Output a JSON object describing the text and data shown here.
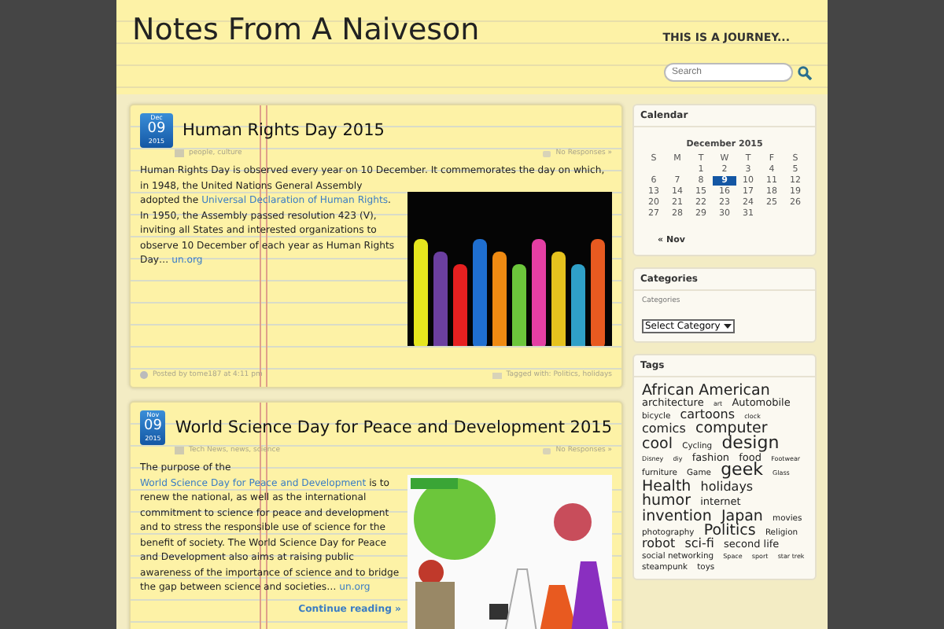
{
  "header": {
    "title": "Notes From A Naiveson",
    "tagline": "THIS IS A JOURNEY...",
    "search": {
      "placeholder": "Search"
    }
  },
  "posts": [
    {
      "date": {
        "month": "Dec",
        "day": "09",
        "year": "2015"
      },
      "title": "Human Rights Day 2015",
      "categories": "people, culture",
      "responses": "No Responses »",
      "body": [
        {
          "text": "Human Rights Day is observed every year on 10 December. It commemorates the day on which, in 1948, the United Nations General Assembly adopted the "
        },
        {
          "text": "Universal Declaration of Human",
          "link": true
        },
        {
          "text": "Rights",
          "link": true
        },
        {
          "text": ". In 1950, the Assembly passed resolution 423 (V), inviting all States and interested organizations to observe 10 December of each year as Human Rights Day… "
        },
        {
          "text": "un.org",
          "link": true
        }
      ],
      "picture": {
        "kind": "hands"
      },
      "footer": {
        "posted": "Posted by tome187 at 4:11 pm",
        "tags": "Tagged with: Politics, holidays"
      }
    },
    {
      "date": {
        "month": "Nov",
        "day": "09",
        "year": "2015"
      },
      "title": "World Science Day for Peace and Development 2015",
      "categories": "Tech News, news, science",
      "responses": "No Responses »",
      "body": [
        {
          "text": "The purpose of the "
        },
        {
          "text": "World Science Day for Peace and Development",
          "link": true
        },
        {
          "text": " is to renew the national, as well as the international commitment to science for peace and development and to stress the responsible use of science for the benefit of society. The World Science Day for Peace and Development also aims at raising public awareness of the importance of science and to bridge the gap between science and societies… "
        },
        {
          "text": "un.org",
          "link": true
        }
      ],
      "continue": "Continue reading »",
      "picture": {
        "kind": "science"
      }
    }
  ],
  "calendar": {
    "title": "Calendar",
    "caption": "December 2015",
    "weekdays": [
      "S",
      "M",
      "T",
      "W",
      "T",
      "F",
      "S"
    ],
    "weeks": [
      {
        "kind": "lead",
        "days": [
          {
            "day": "1",
            "selected": false
          },
          {
            "day": "2",
            "selected": false
          },
          {
            "day": "3",
            "selected": false
          },
          {
            "day": "4",
            "selected": false
          },
          {
            "day": "5",
            "selected": false
          }
        ]
      },
      {
        "kind": "full",
        "days": [
          {
            "day": "6",
            "selected": false
          },
          {
            "day": "7",
            "selected": false
          },
          {
            "day": "8",
            "selected": false
          },
          {
            "day": "9",
            "selected": true
          },
          {
            "day": "10",
            "selected": false
          },
          {
            "day": "11",
            "selected": false
          },
          {
            "day": "12",
            "selected": false
          }
        ]
      },
      {
        "kind": "full",
        "days": [
          {
            "day": "13",
            "selected": false
          },
          {
            "day": "14",
            "selected": false
          },
          {
            "day": "15",
            "selected": false
          },
          {
            "day": "16",
            "selected": false
          },
          {
            "day": "17",
            "selected": false
          },
          {
            "day": "18",
            "selected": false
          },
          {
            "day": "19",
            "selected": false
          }
        ]
      },
      {
        "kind": "full",
        "days": [
          {
            "day": "20",
            "selected": false
          },
          {
            "day": "21",
            "selected": false
          },
          {
            "day": "22",
            "selected": false
          },
          {
            "day": "23",
            "selected": false
          },
          {
            "day": "24",
            "selected": false
          },
          {
            "day": "25",
            "selected": false
          },
          {
            "day": "26",
            "selected": false
          }
        ]
      },
      {
        "kind": "full",
        "days": [
          {
            "day": "27",
            "selected": false
          },
          {
            "day": "28",
            "selected": false
          },
          {
            "day": "29",
            "selected": false
          },
          {
            "day": "30",
            "selected": false
          },
          {
            "day": "31",
            "selected": false
          }
        ]
      }
    ],
    "prev": "« Nov"
  },
  "categories": {
    "title": "Categories",
    "label": "Categories",
    "select": "Select Category"
  },
  "tags": {
    "title": "Tags",
    "items": [
      {
        "text": "African American",
        "kind": "xl"
      },
      {
        "text": "architecture",
        "kind": "m"
      },
      {
        "text": "art",
        "kind": "xs"
      },
      {
        "text": "Automobile",
        "kind": "m"
      },
      {
        "text": "bicycle",
        "kind": "s"
      },
      {
        "text": "cartoons",
        "kind": "l"
      },
      {
        "text": "clock",
        "kind": "xs"
      },
      {
        "text": "comics",
        "kind": "l"
      },
      {
        "text": "computer",
        "kind": "xl"
      },
      {
        "text": "cool",
        "kind": "xl"
      },
      {
        "text": "Cycling",
        "kind": "s"
      },
      {
        "text": "design",
        "kind": "xxl"
      },
      {
        "text": "Disney",
        "kind": "xs"
      },
      {
        "text": "diy",
        "kind": "xs"
      },
      {
        "text": "fashion",
        "kind": "m"
      },
      {
        "text": "food",
        "kind": "m"
      },
      {
        "text": "Footwear",
        "kind": "xs"
      },
      {
        "text": "furniture",
        "kind": "s"
      },
      {
        "text": "Game",
        "kind": "s"
      },
      {
        "text": "geek",
        "kind": "xxl"
      },
      {
        "text": "Glass",
        "kind": "xs"
      },
      {
        "text": "Health",
        "kind": "xl"
      },
      {
        "text": "holidays",
        "kind": "l"
      },
      {
        "text": "humor",
        "kind": "xl"
      },
      {
        "text": "internet",
        "kind": "m"
      },
      {
        "text": "invention",
        "kind": "xl"
      },
      {
        "text": "Japan",
        "kind": "xl"
      },
      {
        "text": "movies",
        "kind": "s"
      },
      {
        "text": "photography",
        "kind": "s"
      },
      {
        "text": "Politics",
        "kind": "xl"
      },
      {
        "text": "Religion",
        "kind": "s"
      },
      {
        "text": "robot",
        "kind": "l"
      },
      {
        "text": "sci-fi",
        "kind": "l"
      },
      {
        "text": "second life",
        "kind": "m"
      },
      {
        "text": "social networking",
        "kind": "s"
      },
      {
        "text": "Space",
        "kind": "xs"
      },
      {
        "text": "sport",
        "kind": "xs"
      },
      {
        "text": "star trek",
        "kind": "xs"
      },
      {
        "text": "steampunk",
        "kind": "s"
      },
      {
        "text": "toys",
        "kind": "s"
      }
    ]
  }
}
